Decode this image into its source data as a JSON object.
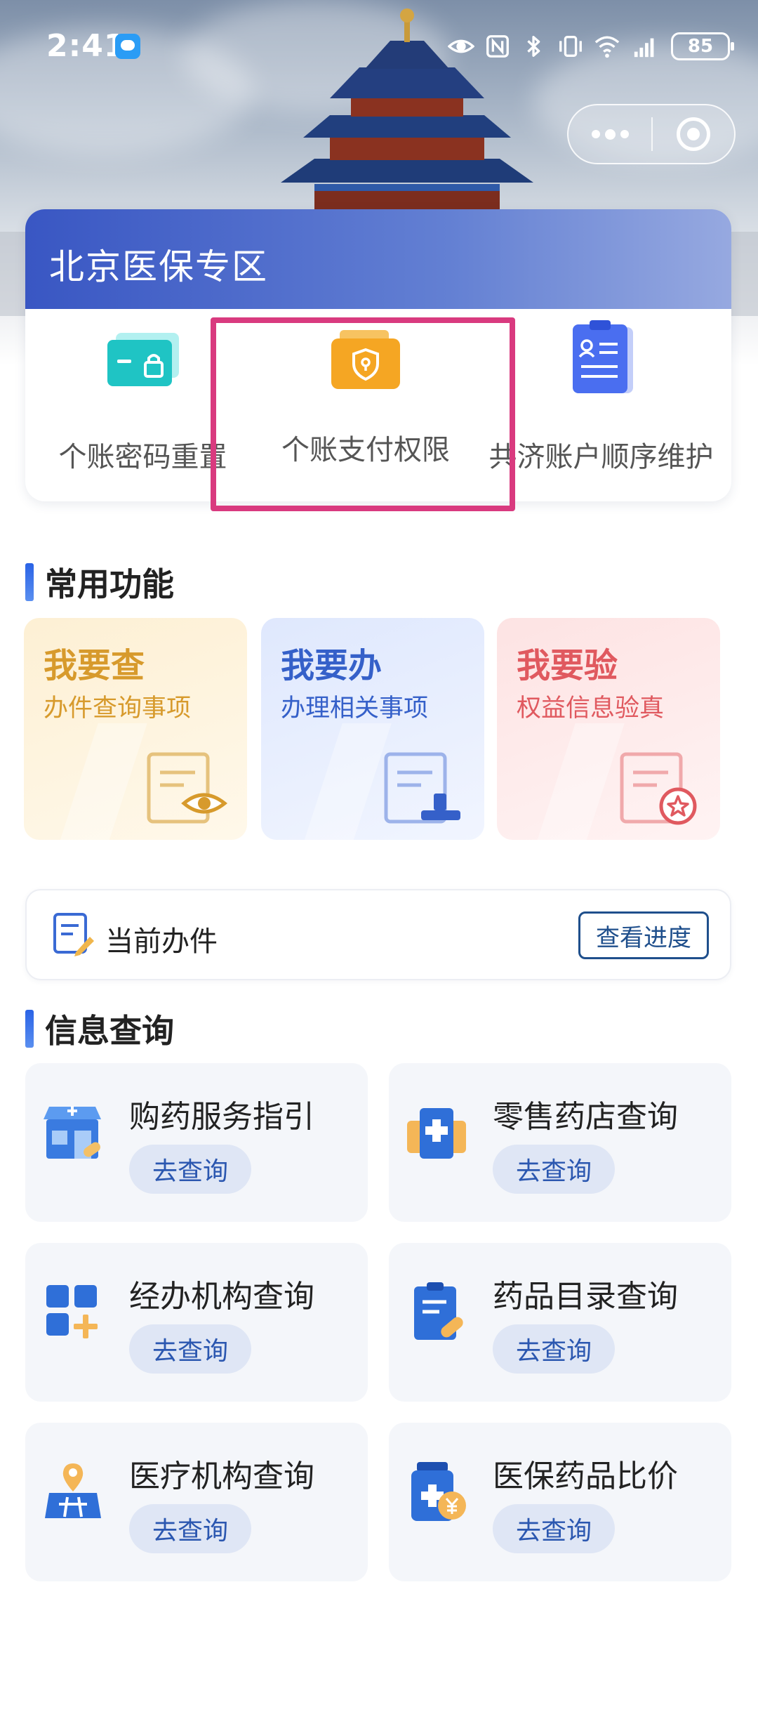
{
  "status_bar": {
    "time": "2:41",
    "battery": "85",
    "icons": [
      "chat-notification-icon",
      "eye-icon",
      "nfc-icon",
      "bluetooth-icon",
      "vibrate-icon",
      "wifi-icon",
      "cellular-signal-icon",
      "battery-icon"
    ]
  },
  "capsule": {
    "more_icon": "more-dots-icon",
    "close_icon": "close-circle-icon"
  },
  "zone": {
    "title": "北京医保专区",
    "items": [
      {
        "label": "个账密码重置",
        "icon": "card-lock-icon",
        "color": "#1fc4c4"
      },
      {
        "label": "个账支付权限",
        "icon": "wallet-shield-icon",
        "color": "#f5a623"
      },
      {
        "label": "共济账户顺序维护",
        "icon": "clipboard-user-icon",
        "color": "#4a6ef0"
      }
    ]
  },
  "highlight_color": "#d93a7f",
  "common": {
    "title": "常用功能",
    "cards": [
      {
        "title": "我要查",
        "subtitle": "办件查询事项",
        "icon": "document-eye-icon",
        "color": "#d79a2c"
      },
      {
        "title": "我要办",
        "subtitle": "办理相关事项",
        "icon": "document-stamp-icon",
        "color": "#3560c9"
      },
      {
        "title": "我要验",
        "subtitle": "权益信息验真",
        "icon": "document-star-icon",
        "color": "#e0595f"
      }
    ]
  },
  "current_task": {
    "label": "当前办件",
    "button": "查看进度",
    "icon": "document-edit-icon"
  },
  "info": {
    "title": "信息查询",
    "items": [
      {
        "title": "购药服务指引",
        "button": "去查询",
        "icon": "pharmacy-store-icon"
      },
      {
        "title": "零售药店查询",
        "button": "去查询",
        "icon": "medical-box-icon"
      },
      {
        "title": "经办机构查询",
        "button": "去查询",
        "icon": "grid-plus-icon"
      },
      {
        "title": "药品目录查询",
        "button": "去查询",
        "icon": "clipboard-pill-icon"
      },
      {
        "title": "医疗机构查询",
        "button": "去查询",
        "icon": "map-pin-icon"
      },
      {
        "title": "医保药品比价",
        "button": "去查询",
        "icon": "medicine-bottle-yuan-icon"
      }
    ]
  }
}
